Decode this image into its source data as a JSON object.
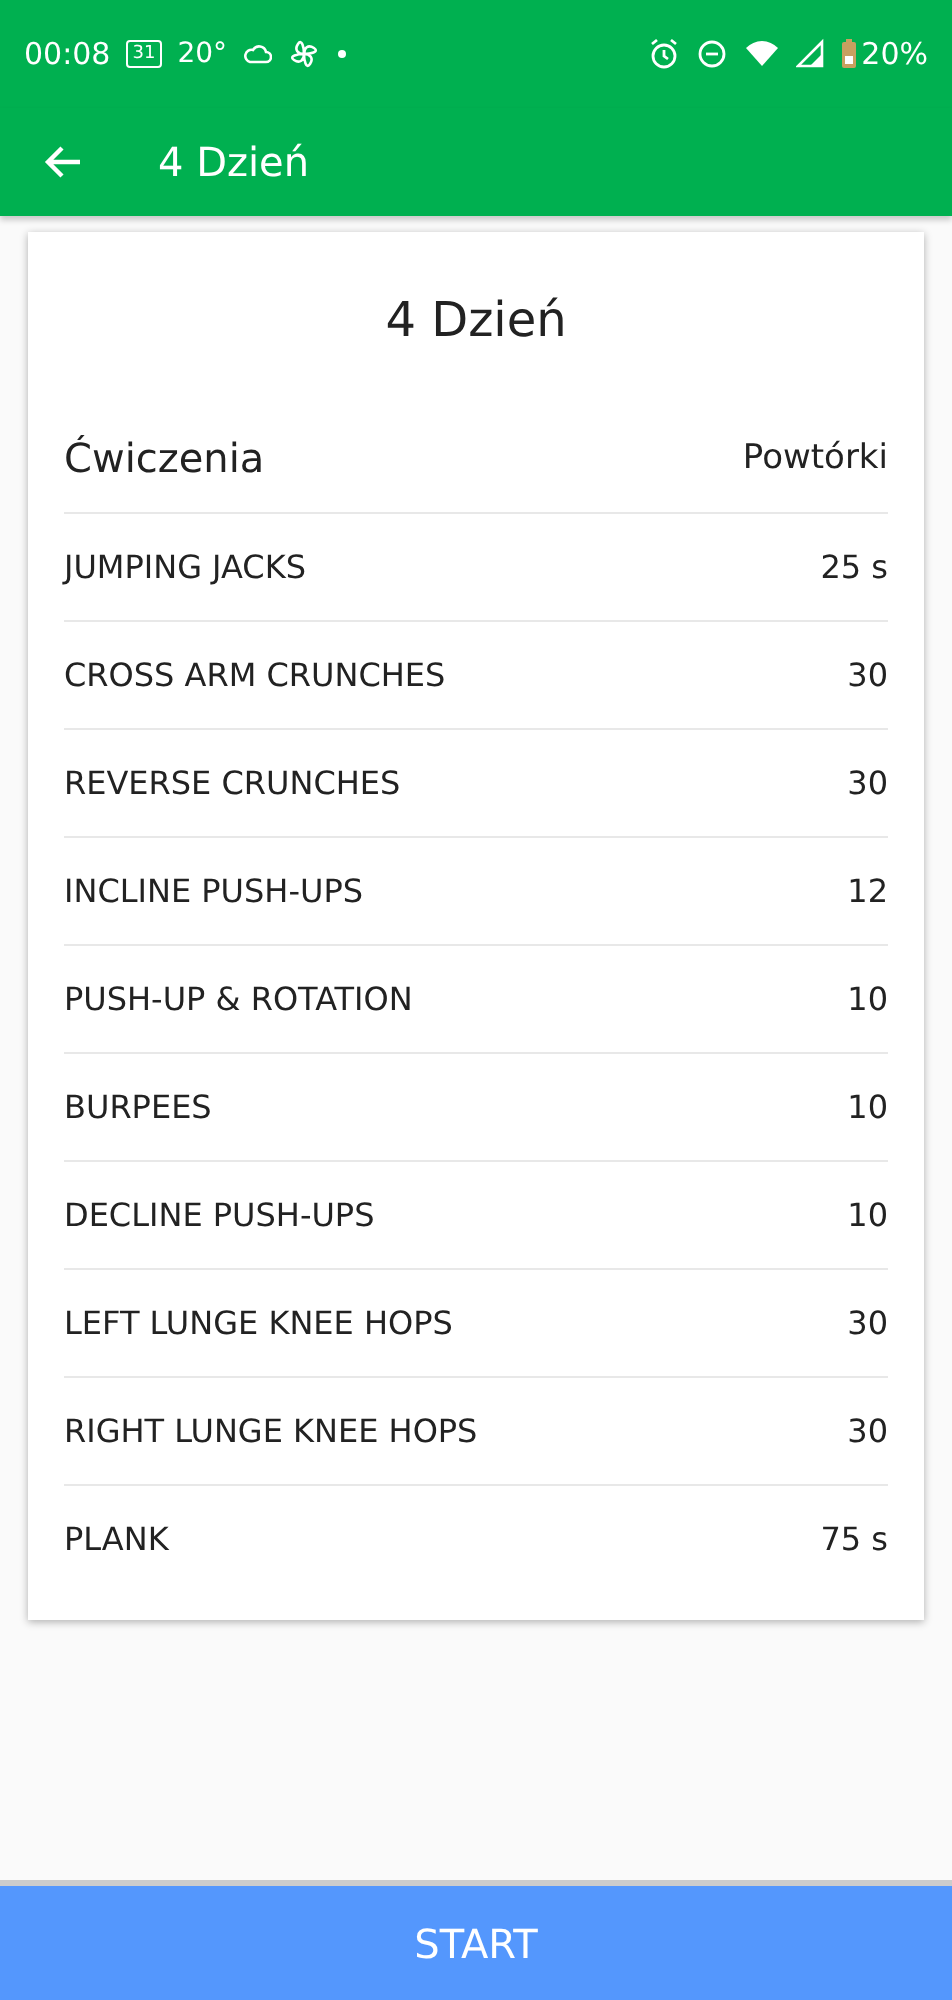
{
  "status_bar": {
    "time": "00:08",
    "calendar_day": "31",
    "temperature": "20°",
    "battery": "20%"
  },
  "app_bar": {
    "title": "4 Dzień"
  },
  "card": {
    "title": "4 Dzień",
    "columns": [
      "Ćwiczenia",
      "Powtórki"
    ],
    "rows": [
      {
        "name": "JUMPING JACKS",
        "reps": "25 s"
      },
      {
        "name": "CROSS ARM CRUNCHES",
        "reps": "30"
      },
      {
        "name": "REVERSE CRUNCHES",
        "reps": "30"
      },
      {
        "name": "INCLINE PUSH-UPS",
        "reps": "12"
      },
      {
        "name": "PUSH-UP & ROTATION",
        "reps": "10"
      },
      {
        "name": "BURPEES",
        "reps": "10"
      },
      {
        "name": "DECLINE PUSH-UPS",
        "reps": "10"
      },
      {
        "name": "LEFT LUNGE KNEE HOPS",
        "reps": "30"
      },
      {
        "name": "RIGHT LUNGE KNEE HOPS",
        "reps": "30"
      },
      {
        "name": "PLANK",
        "reps": "75 s"
      }
    ]
  },
  "start_button": {
    "label": "START"
  }
}
